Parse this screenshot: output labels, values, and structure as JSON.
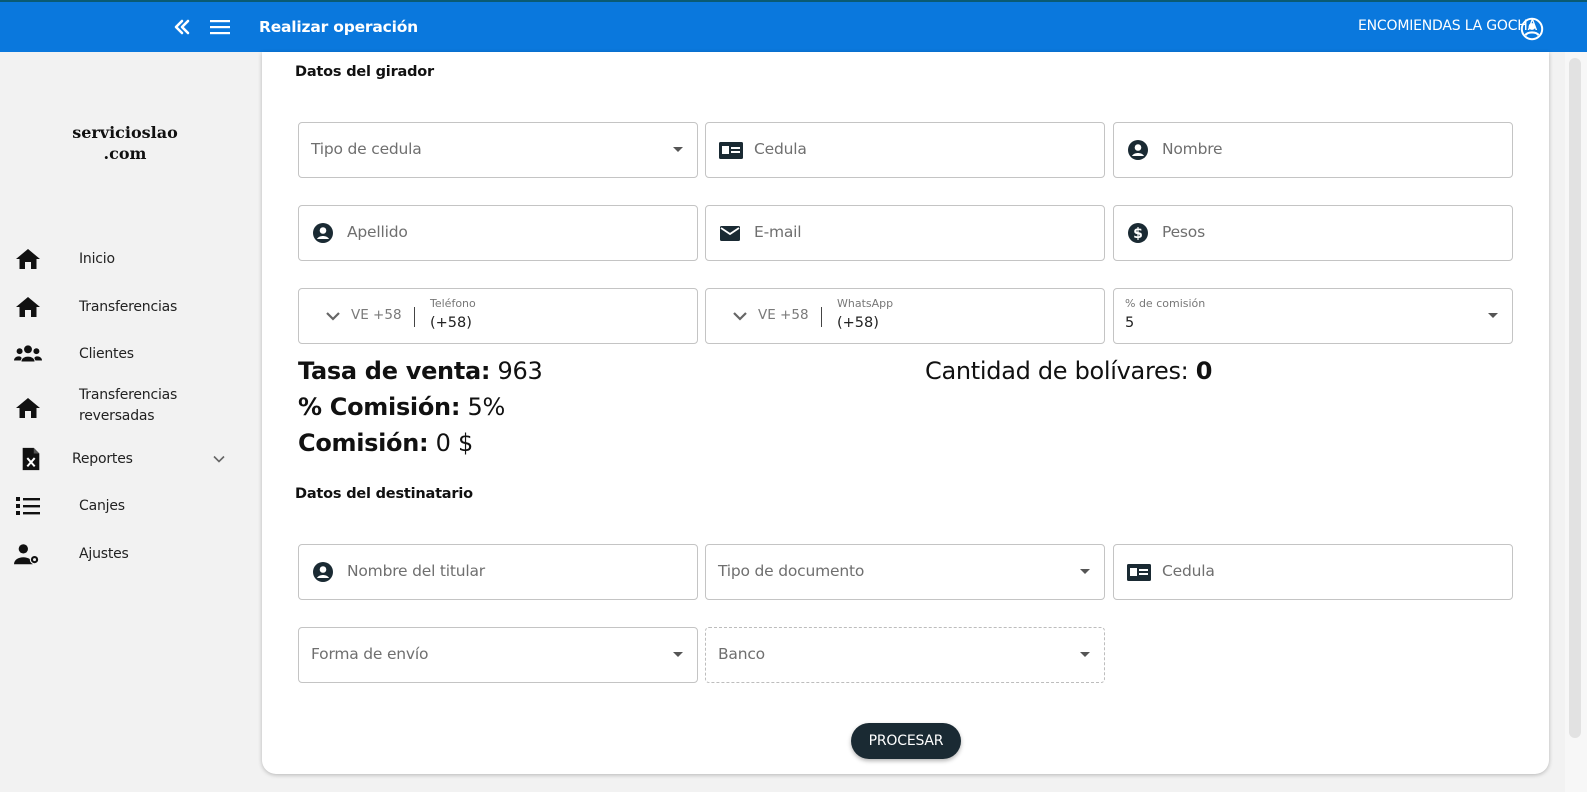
{
  "header": {
    "title": "Realizar operación",
    "user": "ENCOMIENDAS LA GOCHA",
    "color": "#0a78dd"
  },
  "sidebar": {
    "logo_line1": "servicioslao",
    "logo_line2": ".com",
    "items": [
      {
        "label": "Inicio",
        "icon": "home-icon"
      },
      {
        "label": "Transferencias",
        "icon": "home-icon"
      },
      {
        "label": "Clientes",
        "icon": "users-icon"
      },
      {
        "label_line1": "Transferencias",
        "label_line2": "reversadas",
        "icon": "home-icon"
      },
      {
        "label": "Reportes",
        "icon": "excel-file-icon"
      },
      {
        "label": "Canjes",
        "icon": "list-icon"
      },
      {
        "label": "Ajustes",
        "icon": "user-settings-icon"
      }
    ]
  },
  "girador": {
    "section_title": "Datos del girador",
    "tipo_cedula": "Tipo de cedula",
    "cedula": "Cedula",
    "nombre": "Nombre",
    "apellido": "Apellido",
    "email": "E-mail",
    "pesos": "Pesos",
    "telefono": {
      "country": "VE +58",
      "label": "Teléfono",
      "value": "(+58)"
    },
    "whatsapp": {
      "country": "VE +58",
      "label": "WhatsApp",
      "value": "(+58)"
    },
    "comision": {
      "label": "% de comisión",
      "value": "5"
    }
  },
  "summary": {
    "tasa_label": "Tasa de venta:",
    "tasa_value": "963",
    "pct_label": "% Comisión:",
    "pct_value": "5%",
    "comision_label": "Comisión:",
    "comision_value": "0 $",
    "bolivares_label": "Cantidad de bolívares:",
    "bolivares_value": "0"
  },
  "destinatario": {
    "section_title": "Datos del destinatario",
    "nombre_titular": "Nombre del titular",
    "tipo_documento": "Tipo de documento",
    "cedula": "Cedula",
    "forma_envio": "Forma de envío",
    "banco": "Banco"
  },
  "actions": {
    "procesar": "PROCESAR"
  }
}
